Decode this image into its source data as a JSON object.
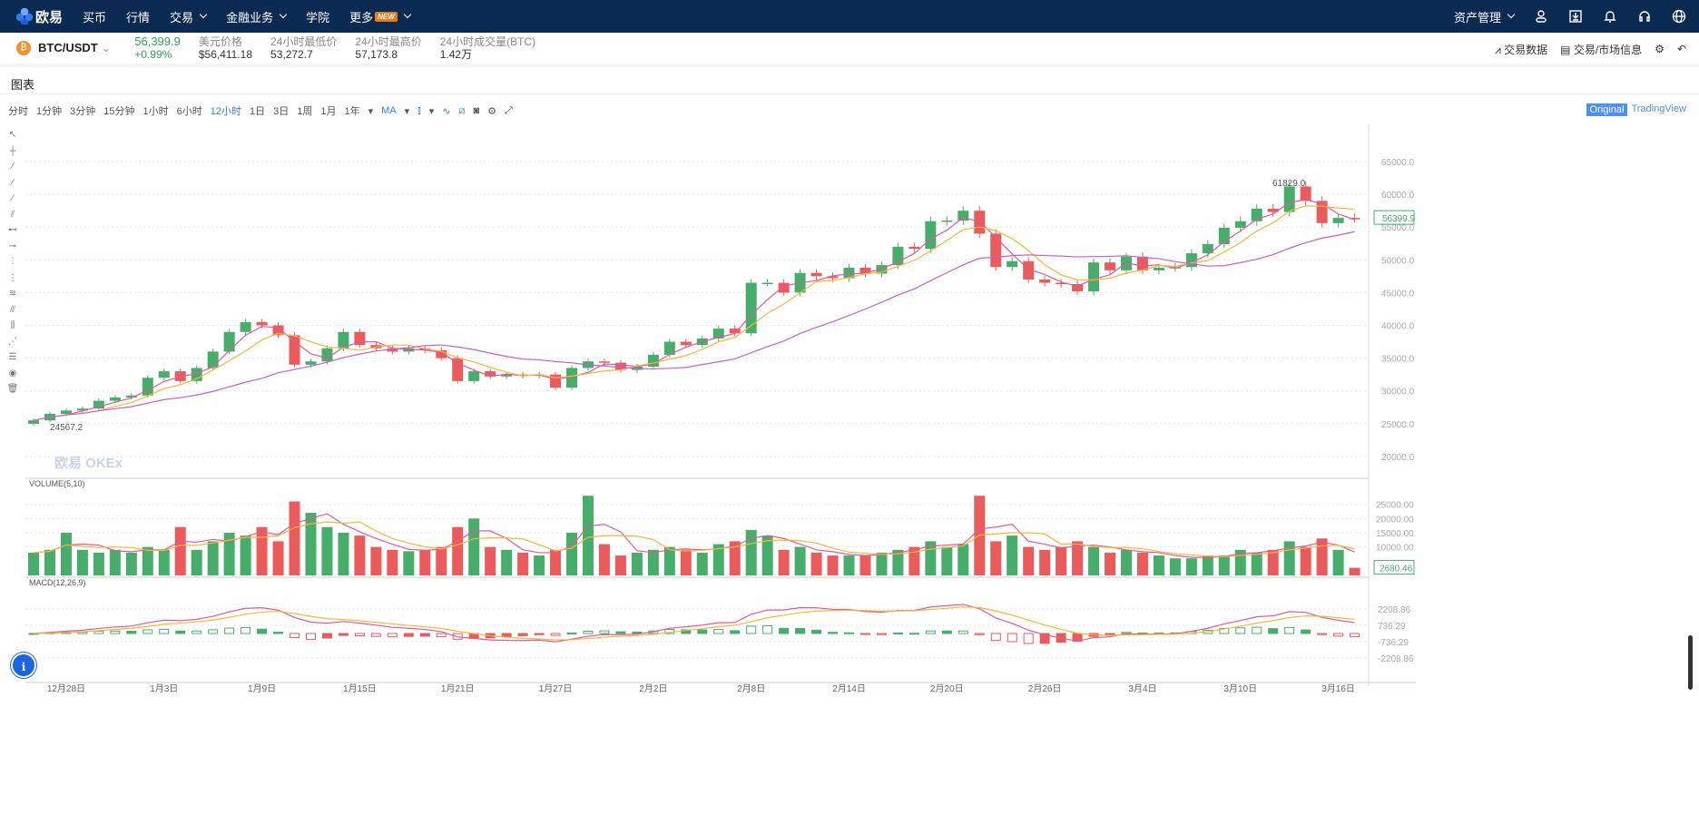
{
  "nav": {
    "logo": "欧易",
    "items": [
      {
        "label": "买币"
      },
      {
        "label": "行情"
      },
      {
        "label": "交易",
        "dropdown": true
      },
      {
        "label": "金融业务",
        "dropdown": true
      },
      {
        "label": "学院"
      },
      {
        "label": "更多",
        "badge": "NEW",
        "dropdown": true
      }
    ],
    "right": {
      "asset_label": "资产管理",
      "icons": [
        "user-icon",
        "download-icon",
        "bell-icon",
        "headset-icon",
        "globe-icon"
      ]
    }
  },
  "ticker": {
    "pair": "BTC/USDT",
    "coin_icon": "bitcoin-icon",
    "price": "56,399.9",
    "change": "+0.99%",
    "stats": [
      {
        "label": "美元价格",
        "value": "$56,411.18"
      },
      {
        "label": "24小时最低价",
        "value": "53,272.7"
      },
      {
        "label": "24小时最高价",
        "value": "57,173.8"
      },
      {
        "label": "24小时成交量(BTC)",
        "value": "1.42万"
      }
    ],
    "links": [
      "交易数据",
      "交易/市场信息"
    ]
  },
  "section_title": "图表",
  "toolbar": {
    "intervals": [
      "分时",
      "1分钟",
      "3分钟",
      "15分钟",
      "1小时",
      "6小时",
      "12小时",
      "1日",
      "3日",
      "1周",
      "1月",
      "1年"
    ],
    "active": "12小时",
    "indicator": "MA",
    "original": "Original",
    "tradingview": "TradingView"
  },
  "colors": {
    "up": "#47ad6b",
    "down": "#ea5b5b",
    "ma1": "#e05a9a",
    "ma2": "#f5b63a",
    "ma3": "#c25fd6",
    "nav_bg": "#0b2a52",
    "accent": "#2e7cf6"
  },
  "watermark": "欧易 OKEx",
  "chart_data": {
    "type": "candlestick",
    "interval": "12小时",
    "x_ticks": [
      "12月28日",
      "1月3日",
      "1月9日",
      "1月15日",
      "1月21日",
      "1月27日",
      "2月2日",
      "2月8日",
      "2月14日",
      "2月20日",
      "2月26日",
      "3月4日",
      "3月10日",
      "3月16日"
    ],
    "price_axis": [
      "65000.0",
      "60000.0",
      "55000.0",
      "50000.0",
      "45000.0",
      "40000.0",
      "35000.0",
      "30000.0",
      "25000.0",
      "20000.0"
    ],
    "ylim": [
      17000,
      68000
    ],
    "last_price": "56399.9",
    "high_marker": "61829.0",
    "low_marker": "24567.2",
    "closes": [
      25500,
      26500,
      27000,
      27300,
      28500,
      29000,
      29300,
      32000,
      33000,
      31500,
      33500,
      36000,
      39000,
      40500,
      40000,
      38500,
      34000,
      34500,
      36500,
      39000,
      37000,
      36500,
      36000,
      36500,
      36200,
      35000,
      31500,
      33000,
      32200,
      32500,
      32300,
      32500,
      30500,
      33500,
      34500,
      34300,
      33200,
      33700,
      35500,
      37500,
      37000,
      38000,
      39500,
      38800,
      46500,
      46500,
      45000,
      48000,
      47500,
      47200,
      48800,
      47900,
      49200,
      52000,
      51700,
      55900,
      56000,
      57500,
      54000,
      48900,
      49800,
      47000,
      46500,
      46300,
      45200,
      49600,
      48400,
      50500,
      48400,
      48800,
      48900,
      51000,
      52400,
      54900,
      55900,
      57800,
      57300,
      61200,
      59000,
      55600,
      56400,
      56399.9
    ],
    "volume": {
      "label": "VOLUME(5,10)",
      "axis": [
        "25000.00",
        "20000.00",
        "15000.00",
        "10000.00"
      ],
      "last": "2680.46",
      "values": [
        8000,
        9000,
        15000,
        9000,
        8000,
        9000,
        8000,
        10000,
        9000,
        17000,
        9000,
        12000,
        15000,
        14000,
        17000,
        12000,
        26000,
        22000,
        17000,
        15000,
        14000,
        10000,
        9000,
        8500,
        9000,
        10000,
        17000,
        20000,
        10000,
        9000,
        8000,
        7000,
        9000,
        15000,
        28000,
        11000,
        7000,
        8000,
        9000,
        10000,
        9000,
        8000,
        11000,
        12000,
        16000,
        14000,
        9000,
        10000,
        8000,
        7000,
        7000,
        7000,
        8000,
        9000,
        10000,
        12000,
        10000,
        11000,
        28000,
        12000,
        14000,
        10000,
        9000,
        10000,
        12000,
        10000,
        8000,
        9000,
        8000,
        7000,
        6000,
        6000,
        7000,
        7000,
        9000,
        8000,
        9000,
        12000,
        10000,
        13000,
        9000,
        2680.46
      ]
    },
    "macd": {
      "label": "MACD(12,26,9)",
      "axis": [
        "2208.86",
        "736.29",
        "-736.29",
        "-2208.86"
      ]
    }
  }
}
